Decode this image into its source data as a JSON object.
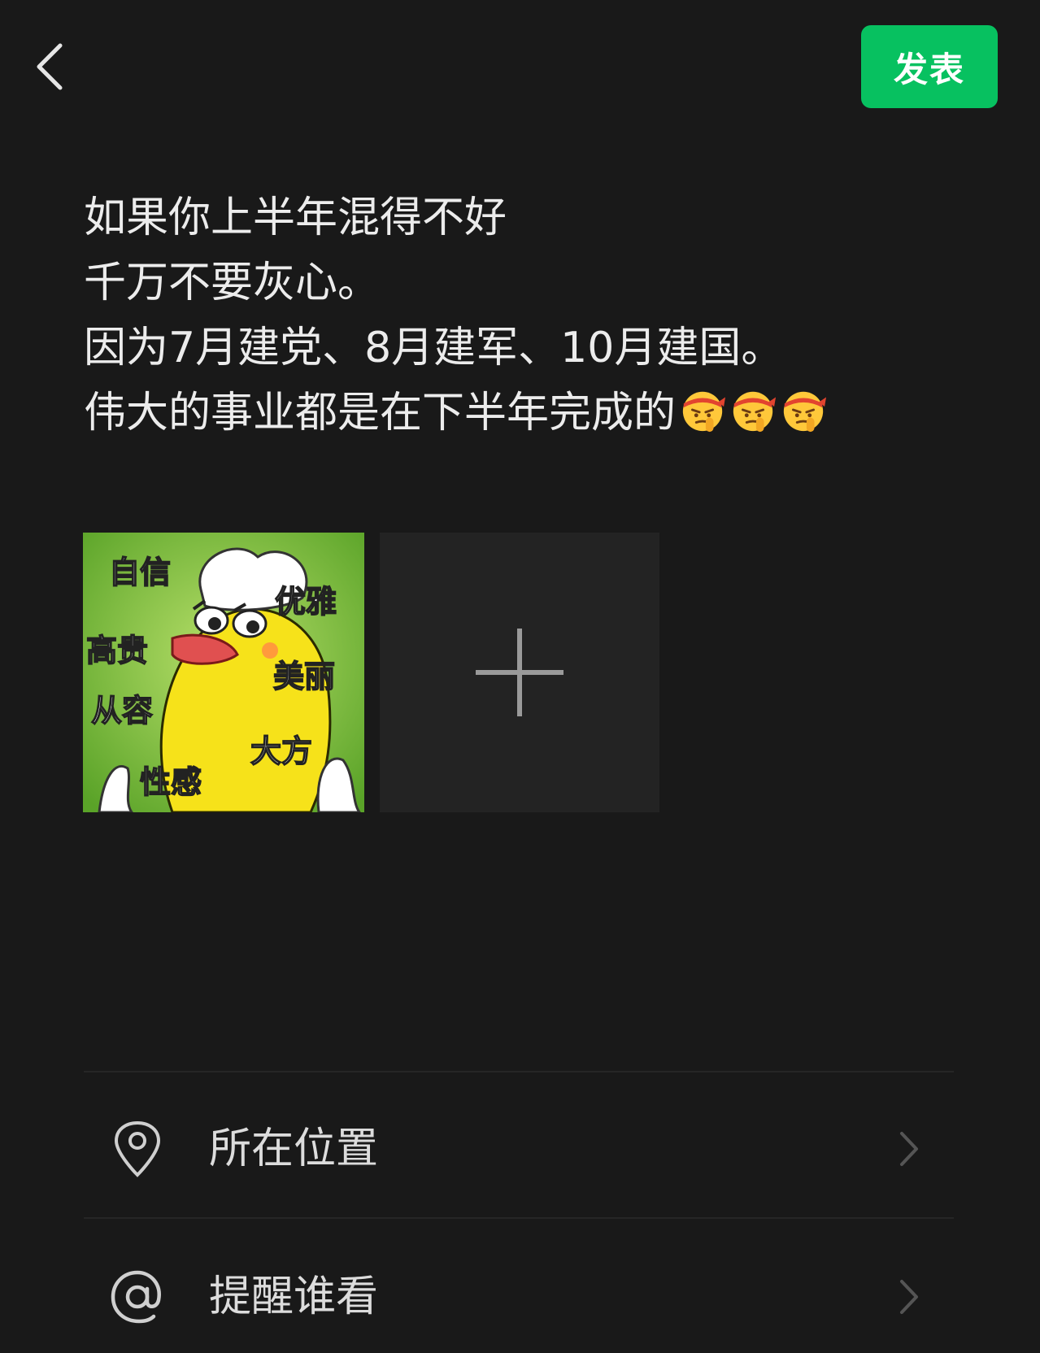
{
  "header": {
    "back_icon": "chevron-left-icon",
    "publish_label": "发表",
    "publish_color": "#07c160"
  },
  "post": {
    "lines": [
      "如果你上半年混得不好",
      "千万不要灰心。",
      "因为7月建党、8月建军、10月建国。",
      "伟大的事业都是在下半年完成的"
    ],
    "trailing_emoji": [
      "shushing-face-headband-emoji",
      "shushing-face-headband-emoji",
      "shushing-face-headband-emoji"
    ]
  },
  "images": {
    "thumbnail_words": [
      "自信",
      "优雅",
      "高贵",
      "美丽",
      "从容",
      "大方",
      "性感"
    ],
    "add_icon": "plus-icon"
  },
  "options": [
    {
      "icon": "location-pin-icon",
      "label": "所在位置"
    },
    {
      "icon": "at-sign-icon",
      "label": "提醒谁看"
    }
  ],
  "colors": {
    "background": "#191919",
    "accent": "#07c160",
    "tile": "#232323"
  }
}
